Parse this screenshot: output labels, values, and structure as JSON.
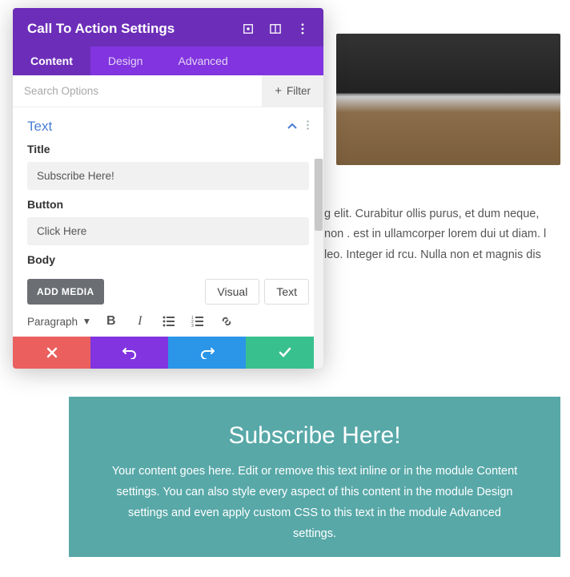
{
  "modal": {
    "title": "Call To Action Settings",
    "tabs": {
      "content": "Content",
      "design": "Design",
      "advanced": "Advanced"
    },
    "search": {
      "placeholder": "Search Options"
    },
    "filter_label": "Filter",
    "section": {
      "title": "Text"
    },
    "fields": {
      "title_label": "Title",
      "title_value": "Subscribe Here!",
      "button_label": "Button",
      "button_value": "Click Here",
      "body_label": "Body"
    },
    "editor": {
      "add_media": "ADD MEDIA",
      "tab_visual": "Visual",
      "tab_text": "Text",
      "para": "Paragraph"
    }
  },
  "page": {
    "lorem": "g elit. Curabitur ollis purus, et dum neque, non . est in ullamcorper lorem dui ut diam. l leo. Integer id rcu. Nulla non et magnis dis",
    "cta_title": "Subscribe Here!",
    "cta_body": "Your content goes here. Edit or remove this text inline or in the module Content settings. You can also style every aspect of this content in the module Design settings and even apply custom CSS to this text in the module Advanced settings."
  }
}
